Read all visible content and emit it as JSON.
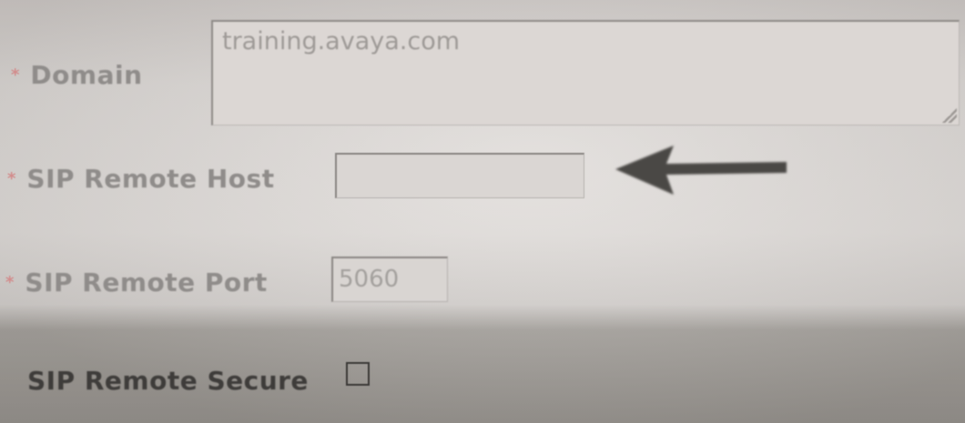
{
  "form": {
    "domain": {
      "label": "Domain",
      "required": "*",
      "value": "training.avaya.com"
    },
    "sip_remote_host": {
      "label": "SIP Remote Host",
      "required": "*",
      "value": ""
    },
    "sip_remote_port": {
      "label": "SIP Remote Port",
      "required": "*",
      "value": "5060"
    },
    "sip_remote_secure": {
      "label": "SIP Remote Secure",
      "checked": false
    }
  },
  "annotation": {
    "arrow_icon": "arrow-left-icon",
    "arrow_color": "#4a4845"
  }
}
